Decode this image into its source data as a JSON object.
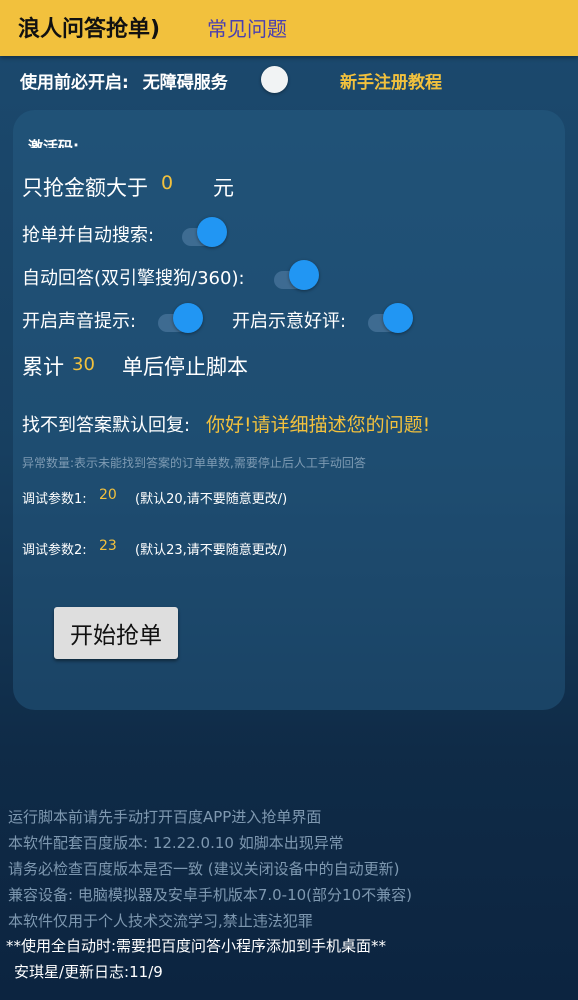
{
  "header": {
    "title": "浪人问答抢单)",
    "faq_link": "常见问题"
  },
  "prerequisite": {
    "label": "使用前必开启:",
    "service_label": "无障碍服务",
    "service_enabled": false,
    "tutorial_link": "新手注册教程"
  },
  "settings": {
    "panel_label": "激活码:",
    "amount_prefix": "只抢金额大于",
    "amount_value": "0",
    "amount_suffix": "元",
    "auto_search_label": "抢单并自动搜索:",
    "auto_search_enabled": true,
    "auto_answer_label": "自动回答(双引擎搜狗/360):",
    "auto_answer_enabled": true,
    "sound_label": "开启声音提示:",
    "sound_enabled": true,
    "praise_label": "开启示意好评:",
    "praise_enabled": true,
    "total_prefix": "累计",
    "total_value": "30",
    "total_suffix": "单后停止脚本",
    "default_reply_label": "找不到答案默认回复:",
    "default_reply_value": "你好!请详细描述您的问题!",
    "hint": "异常数量:表示未能找到答案的订单单数,需要停止后人工手动回答",
    "param1_label": "调试参数1:",
    "param1_value": "20",
    "param1_note": "(默认20,请不要随意更改/)",
    "param2_label": "调试参数2:",
    "param2_value": "23",
    "param2_note": "(默认23,请不要随意更改/)",
    "start_button": "开始抢单"
  },
  "info_lines": [
    "运行脚本前请先手动打开百度APP进入抢单界面",
    "本软件配套百度版本: 12.22.0.10  如脚本出现异常",
    "请务必检查百度版本是否一致 (建议关闭设备中的自动更新)",
    "兼容设备: 电脑模拟器及安卓手机版本7.0-10(部分10不兼容)",
    "本软件仅用于个人技术交流学习,禁止违法犯罪",
    "**使用全自动时:需要把百度问答小程序添加到手机桌面**",
    "安琪星/更新日志:11/9"
  ],
  "colors": {
    "accent": "#f2c13d",
    "toggle_on": "#2196f3",
    "link": "#4a3fb0"
  }
}
